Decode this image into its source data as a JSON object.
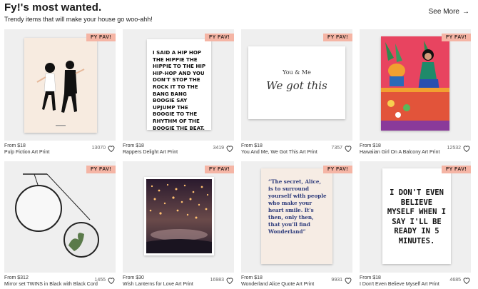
{
  "section": {
    "title": "Fy!'s most wanted.",
    "subtitle": "Trendy items that will make your house go woo-ahh!",
    "see_more": "See More"
  },
  "products": [
    {
      "badge": "FY FAV!",
      "price": "From $18",
      "name": "Pulp Fiction Art Print",
      "likes": "13070"
    },
    {
      "badge": "FY FAV!",
      "price": "From $18",
      "name": "Rappers Delight Art Print",
      "likes": "3419",
      "art_text": "I SAID A HIP HOP THE HIPPIE THE HIPPIE TO THE HIP HIP-HOP AND YOU DON'T STOP THE ROCK IT TO THE BANG BANG BOOGIE SAY UPJUMP THE BOOGIE TO THE RHYTHM OF THE BOOGIE THE BEAT."
    },
    {
      "badge": "FY FAV!",
      "price": "From $18",
      "name": "You And Me, We Got This Art Print",
      "likes": "7357",
      "art_line1": "You & Me",
      "art_line2": "We got this"
    },
    {
      "badge": "FY FAV!",
      "price": "From $18",
      "name": "Hawaiian Girl On A Balcony Art Print",
      "likes": "12532"
    },
    {
      "badge": "FY FAV!",
      "price": "From $312",
      "name": "Mirror set TWINS in Black with Black Cord",
      "likes": "1455"
    },
    {
      "badge": "FY FAV!",
      "price": "From $30",
      "name": "Wish Lanterns for Love Art Print",
      "likes": "16983"
    },
    {
      "badge": "FY FAV!",
      "price": "From $18",
      "name": "Wonderland Alice Quote Art Print",
      "likes": "9931",
      "art_text": "“The secret, Alice, is to surround yourself with people who make your heart smile. It's then, only then, that you'll find Wonderland”"
    },
    {
      "badge": "FY FAV!",
      "price": "From $18",
      "name": "I Don't Even Believe Myself Art Print",
      "likes": "4685",
      "art_text": "I DON'T EVEN BELIEVE MYSELF WHEN I SAY I'LL BE READY IN 5 MINUTES."
    }
  ],
  "colors": {
    "badge_bg": "#f5b5a5",
    "thumb_bg": "#efefef"
  },
  "icons": {
    "heart": "heart-icon",
    "arrow": "arrow-right-icon"
  }
}
